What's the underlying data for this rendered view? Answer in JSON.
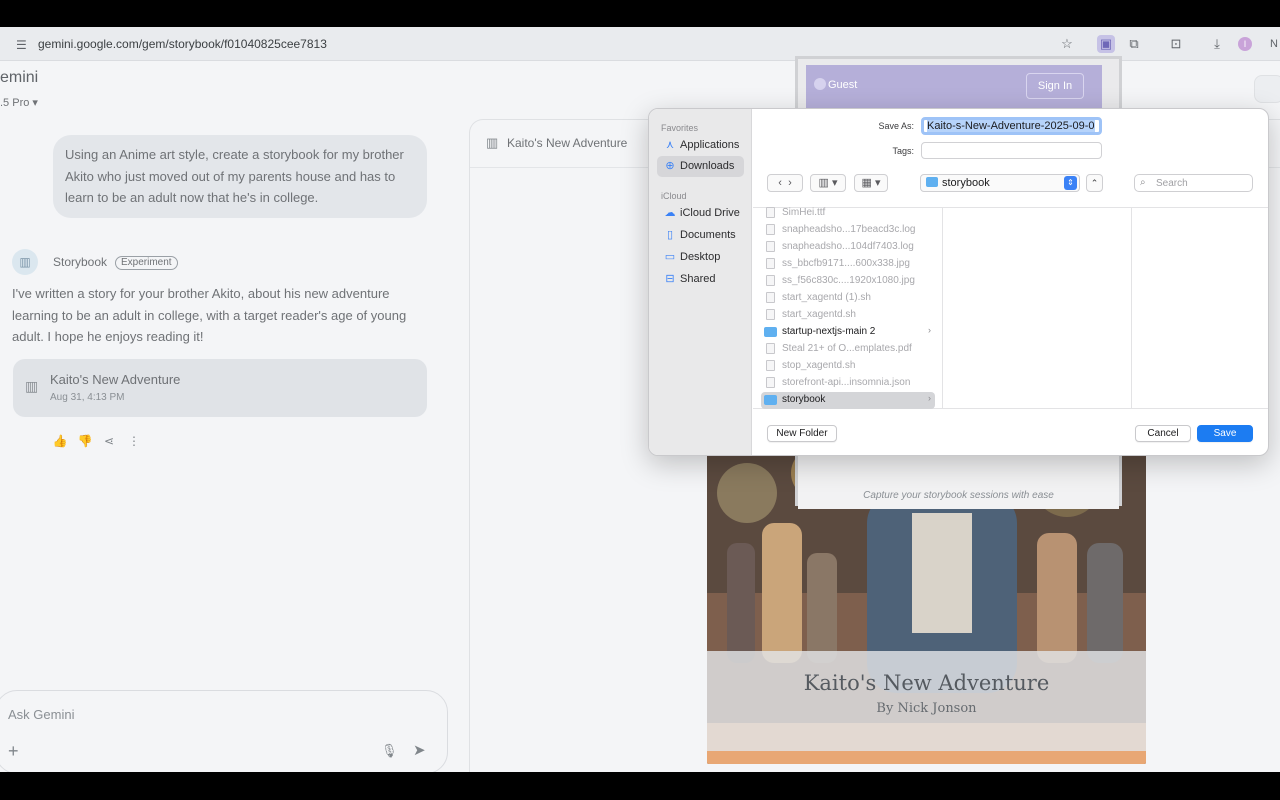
{
  "browser": {
    "url": "gemini.google.com/gem/storybook/f01040825cee7813",
    "profile_initial": "I",
    "overflow_text": "N",
    "icons": [
      "tune-icon",
      "star-icon",
      "extension-storybook-icon",
      "extensions-puzzle-icon",
      "tab-search-icon",
      "download-icon"
    ]
  },
  "gemini": {
    "title": "emini",
    "model": ".5 Pro",
    "user_message": "Using an Anime art style, create a storybook for my brother Akito who just moved out of my parents house and has to learn to be an adult now that he's in college.",
    "assistant_name": "Storybook",
    "assistant_badge": "Experiment",
    "reply": "I've written a story for your brother Akito, about his new adventure learning to be an adult in college, with a target reader's age of young adult. I hope he enjoys reading it!",
    "card": {
      "title": "Kaito's New Adventure",
      "date": "Aug 31, 4:13 PM"
    },
    "input_placeholder": "Ask Gemini"
  },
  "panel": {
    "title": "Kaito's New Adventure",
    "book_title": "Kaito's New Adventure",
    "book_author": "By Nick Jonson"
  },
  "extension": {
    "user": "Guest",
    "sign_in": "Sign In",
    "caption": "Capture your storybook sessions with ease"
  },
  "dialog": {
    "save_as_label": "Save As:",
    "save_as_value": "Kaito-s-New-Adventure-2025-09-0",
    "tags_label": "Tags:",
    "location": "storybook",
    "search_placeholder": "Search",
    "sidebar": {
      "favorites_header": "Favorites",
      "favorites": [
        {
          "label": "Applications",
          "icon": "applications-icon"
        },
        {
          "label": "Downloads",
          "icon": "downloads-icon",
          "selected": true
        }
      ],
      "icloud_header": "iCloud",
      "icloud": [
        {
          "label": "iCloud Drive",
          "icon": "icloud-icon"
        },
        {
          "label": "Documents",
          "icon": "documents-icon"
        },
        {
          "label": "Desktop",
          "icon": "desktop-icon"
        },
        {
          "label": "Shared",
          "icon": "shared-folder-icon"
        }
      ]
    },
    "files": [
      {
        "name": "SimHei.ttf",
        "kind": "file"
      },
      {
        "name": "snapheadsho...17beacd3c.log",
        "kind": "file"
      },
      {
        "name": "snapheadsho...104df7403.log",
        "kind": "file"
      },
      {
        "name": "ss_bbcfb9171....600x338.jpg",
        "kind": "image"
      },
      {
        "name": "ss_f56c830c....1920x1080.jpg",
        "kind": "image"
      },
      {
        "name": "start_xagentd (1).sh",
        "kind": "file"
      },
      {
        "name": "start_xagentd.sh",
        "kind": "file"
      },
      {
        "name": "startup-nextjs-main 2",
        "kind": "folder"
      },
      {
        "name": "Steal 21+ of O...emplates.pdf",
        "kind": "file"
      },
      {
        "name": "stop_xagentd.sh",
        "kind": "file"
      },
      {
        "name": "storefront-api...insomnia.json",
        "kind": "file"
      },
      {
        "name": "storybook",
        "kind": "folder",
        "selected": true
      }
    ],
    "new_folder": "New Folder",
    "cancel": "Cancel",
    "save": "Save"
  },
  "colors": {
    "accent": "#1c7cf2",
    "folder": "#5fb0f0",
    "selection": "#b6d3fa"
  }
}
